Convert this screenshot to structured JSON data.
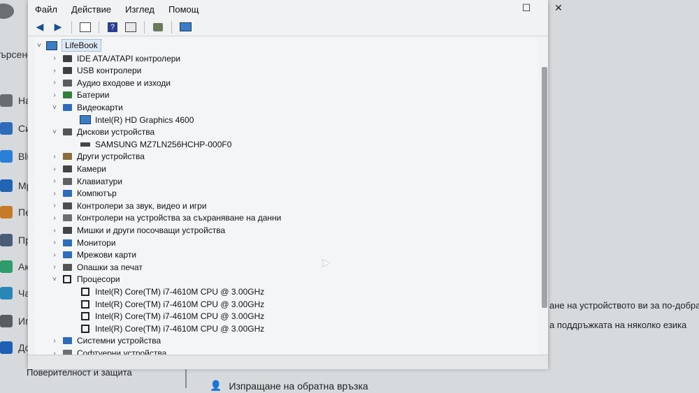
{
  "menu": {
    "file": "Файл",
    "action": "Действие",
    "view": "Изглед",
    "help": "Помощ"
  },
  "window_controls": {
    "maximize": "☐",
    "close": "✕"
  },
  "tree": {
    "root": "LifeBook",
    "categories": [
      {
        "label": "IDE ATA/ATAPI контролери",
        "expanded": false,
        "children": []
      },
      {
        "label": "USB контролери",
        "expanded": false,
        "children": []
      },
      {
        "label": "Аудио входове и изходи",
        "expanded": false,
        "children": []
      },
      {
        "label": "Батерии",
        "expanded": false,
        "children": []
      },
      {
        "label": "Видеокарти",
        "expanded": true,
        "children": [
          "Intel(R) HD Graphics 4600"
        ]
      },
      {
        "label": "Дискови устройства",
        "expanded": true,
        "children": [
          "SAMSUNG MZ7LN256HCHP-000F0"
        ]
      },
      {
        "label": "Други устройства",
        "expanded": false,
        "children": []
      },
      {
        "label": "Камери",
        "expanded": false,
        "children": []
      },
      {
        "label": "Клавиатури",
        "expanded": false,
        "children": []
      },
      {
        "label": "Компютър",
        "expanded": false,
        "children": []
      },
      {
        "label": "Контролери за звук, видео и игри",
        "expanded": false,
        "children": []
      },
      {
        "label": "Контролери на устройства за съхраняване на данни",
        "expanded": false,
        "children": []
      },
      {
        "label": "Мишки и други посочващи устройства",
        "expanded": false,
        "children": []
      },
      {
        "label": "Монитори",
        "expanded": false,
        "children": []
      },
      {
        "label": "Мрежови карти",
        "expanded": false,
        "children": []
      },
      {
        "label": "Опашки за печат",
        "expanded": false,
        "children": []
      },
      {
        "label": "Процесори",
        "expanded": true,
        "children": [
          "Intel(R) Core(TM) i7-4610M CPU @ 3.00GHz",
          "Intel(R) Core(TM) i7-4610M CPU @ 3.00GHz",
          "Intel(R) Core(TM) i7-4610M CPU @ 3.00GHz",
          "Intel(R) Core(TM) i7-4610M CPU @ 3.00GHz"
        ]
      },
      {
        "label": "Системни устройства",
        "expanded": false,
        "children": []
      },
      {
        "label": "Софтуерни устройства",
        "expanded": false,
        "children": []
      }
    ]
  },
  "background": {
    "search_fragment": "ърсене",
    "nav_fragments": [
      "На",
      "Си",
      "Blu",
      "Мр",
      "Пе",
      "Пр",
      "Ака",
      "Час",
      "Игр",
      "До"
    ],
    "bottom_left": "Поверителност и защита",
    "right_text_1": "ане на устройството ви за по-добра",
    "right_text_2": "а поддръжката на няколко езика",
    "feedback": "Изпращане на обратна връзка"
  },
  "colors": {
    "accent": "#1d3c6e",
    "selection": "#dfe8f5"
  }
}
